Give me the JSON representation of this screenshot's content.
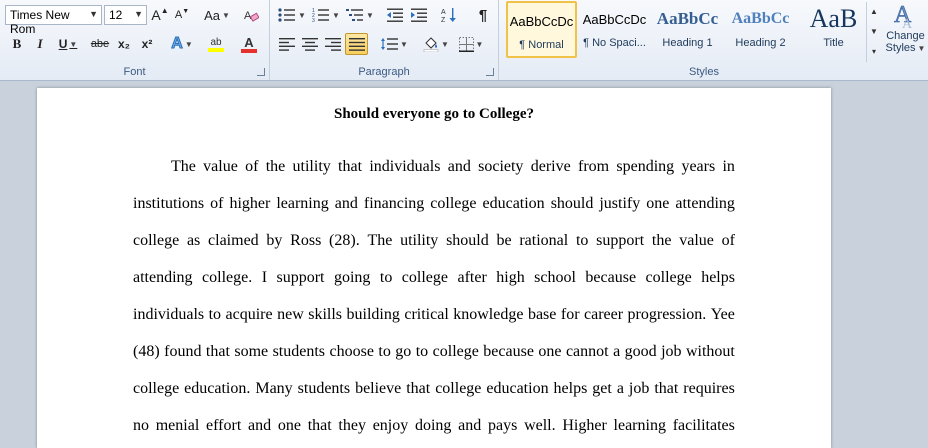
{
  "font": {
    "label": "Font",
    "family": "Times New Rom",
    "size": "12",
    "grow_glyph": "A",
    "shrink_glyph": "A",
    "case_glyph": "Aa",
    "bold": "B",
    "italic": "I",
    "underline": "U",
    "strike": "abe",
    "subscript": "x₂",
    "superscript": "x²",
    "text_effects": "A",
    "highlight": "ab",
    "font_color": "A"
  },
  "paragraph": {
    "label": "Paragraph",
    "pilcrow": "¶"
  },
  "styles": {
    "label": "Styles",
    "items": [
      {
        "sample": "AaBbCcDc",
        "name": "¶ Normal"
      },
      {
        "sample": "AaBbCcDc",
        "name": "¶ No Spaci..."
      },
      {
        "sample": "AaBbCc",
        "name": "Heading 1"
      },
      {
        "sample": "AaBbCc",
        "name": "Heading 2"
      },
      {
        "sample": "AaB",
        "name": "Title"
      }
    ],
    "change_styles_line1": "Change",
    "change_styles_line2": "Styles"
  },
  "colors": {
    "highlight": "#ffff00",
    "font_color": "#e5322d",
    "selected_border": "#f0c247"
  },
  "document": {
    "title": "Should everyone go to College?",
    "lines": [
      "The value of the utility that individuals and society derive from spending years in",
      "institutions of higher learning and financing college education should justify one attending",
      "college as claimed by Ross (28). The utility should be rational to support the value of",
      "attending college. I support going to college after high school because college helps",
      "individuals to acquire new skills building critical knowledge base for career progression. Yee",
      "(48) found that some students choose to go to college because one cannot a good job without",
      "college education. Many students believe that college education helps get a job that requires",
      "no menial effort and one that they enjoy doing and pays well. Higher learning facilitates"
    ]
  }
}
